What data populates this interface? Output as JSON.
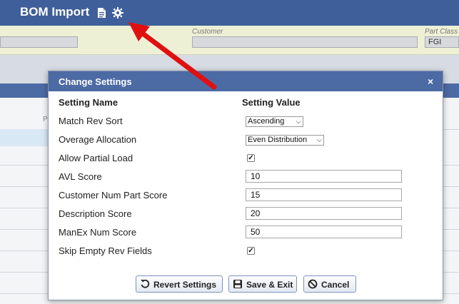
{
  "page": {
    "title": "BOM Import",
    "filters": {
      "customer_label": "Customer",
      "part_class_label": "Part Class",
      "part_class_value": "FGI"
    },
    "grid_hint": "P"
  },
  "dialog": {
    "title": "Change Settings",
    "close_glyph": "×",
    "col_name": "Setting Name",
    "col_value": "Setting Value",
    "settings": [
      {
        "name": "Match Rev Sort",
        "type": "select",
        "value": "Ascending"
      },
      {
        "name": "Overage Allocation",
        "type": "select",
        "value": "Even Distribution"
      },
      {
        "name": "Allow Partial Load",
        "type": "checkbox",
        "checked": true
      },
      {
        "name": "AVL Score",
        "type": "text",
        "value": "10"
      },
      {
        "name": "Customer Num Part Score",
        "type": "text",
        "value": "15"
      },
      {
        "name": "Description Score",
        "type": "text",
        "value": "20"
      },
      {
        "name": "ManEx Num Score",
        "type": "text",
        "value": "50"
      },
      {
        "name": "Skip Empty Rev Fields",
        "type": "checkbox",
        "checked": true
      }
    ],
    "buttons": {
      "revert": "Revert Settings",
      "save": "Save & Exit",
      "cancel": "Cancel"
    }
  },
  "icons": {
    "header_doc": "document-icon",
    "header_settings": "gear-icon",
    "revert": "undo-icon",
    "save": "floppy-disk-icon",
    "cancel": "ban-icon"
  },
  "colors": {
    "header_blue": "#3f5f9a",
    "dialog_blue": "#4c6aa4",
    "filter_bg": "#eef0d6",
    "annotation_arrow": "#e01010"
  }
}
